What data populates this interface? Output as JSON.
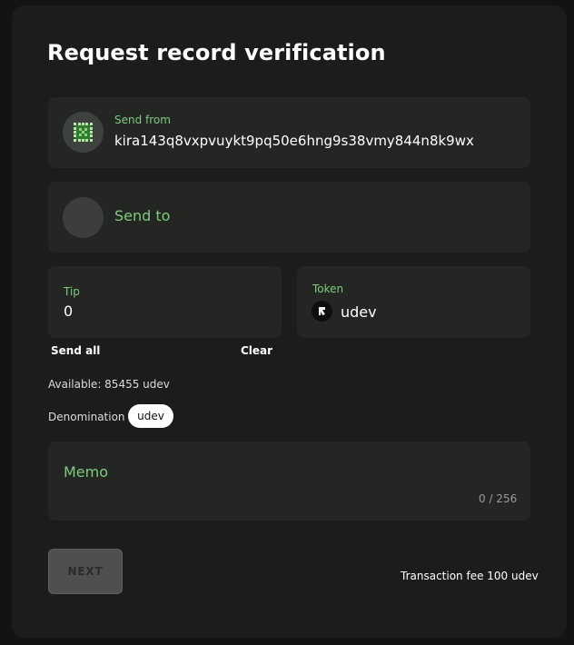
{
  "dialog": {
    "title": "Request record verification"
  },
  "send_from": {
    "label": "Send from",
    "address": "kira143q8vxpvuykt9pq50e6hng9s38vmy844n8k9wx"
  },
  "send_to": {
    "placeholder": "Send to"
  },
  "tip": {
    "label": "Tip",
    "value": "0",
    "send_all_label": "Send all",
    "clear_label": "Clear"
  },
  "token": {
    "label": "Token",
    "value": "udev"
  },
  "available": {
    "text": "Available: 85455 udev"
  },
  "denomination": {
    "label": "Denomination",
    "selected": "udev"
  },
  "memo": {
    "placeholder": "Memo",
    "counter": "0 / 256"
  },
  "footer": {
    "next_label": "NEXT",
    "fee_text": "Transaction fee 100 udev"
  },
  "colors": {
    "accent_green": "#7ecb7e",
    "background": "#121412",
    "dialog": "#1b1d1b",
    "card": "#232623"
  },
  "icons": {
    "from_avatar": "identicon-avatar",
    "to_avatar": "empty-avatar",
    "token": "kira-token-icon"
  }
}
